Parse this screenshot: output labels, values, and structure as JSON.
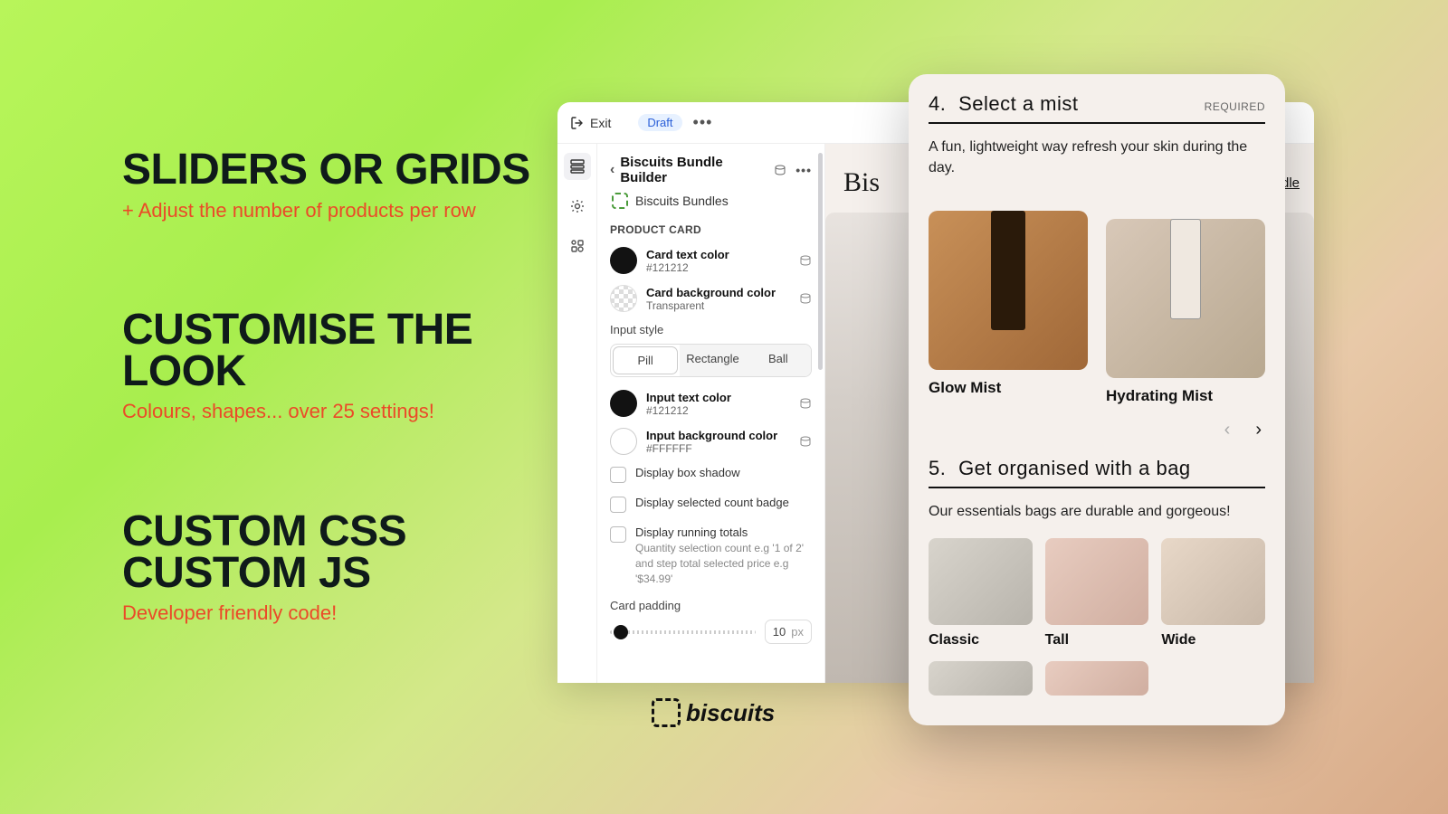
{
  "marketing": {
    "block1": {
      "headline": "SLIDERS OR GRIDS",
      "subline": "+ Adjust the number of products per row"
    },
    "block2": {
      "headline": "CUSTOMISE THE LOOK",
      "subline": "Colours, shapes... over 25 settings!"
    },
    "block3": {
      "headline_a": "CUSTOM CSS",
      "headline_b": "CUSTOM JS",
      "subline": "Developer friendly code!"
    }
  },
  "editor": {
    "exit": "Exit",
    "badge": "Draft",
    "panel_title": "Biscuits Bundle Builder",
    "breadcrumb": "Biscuits Bundles",
    "section": "PRODUCT CARD",
    "card_text_color": {
      "label": "Card text color",
      "value": "#121212"
    },
    "card_bg_color": {
      "label": "Card background color",
      "value": "Transparent"
    },
    "input_style_label": "Input style",
    "input_style": {
      "opt1": "Pill",
      "opt2": "Rectangle",
      "opt3": "Ball"
    },
    "input_text_color": {
      "label": "Input text color",
      "value": "#121212"
    },
    "input_bg_color": {
      "label": "Input background color",
      "value": "#FFFFFF"
    },
    "check_shadow": "Display box shadow",
    "check_badge": "Display selected count badge",
    "check_totals": {
      "label": "Display running totals",
      "sub": "Quantity selection count e.g '1 of 2' and step total selected price e.g '$34.99'"
    },
    "padding_label": "Card padding",
    "padding_value": "10",
    "padding_unit": "px"
  },
  "preview": {
    "brand": "Bis",
    "link": "Skincare Bundle"
  },
  "overlay": {
    "step4": {
      "num": "4.",
      "title": "Select a mist",
      "required": "REQUIRED",
      "desc": "A fun, lightweight way refresh your skin during the day."
    },
    "mist1": "Glow Mist",
    "mist2": "Hydrating Mist",
    "step5": {
      "num": "5.",
      "title": "Get organised with a bag",
      "desc": "Our essentials bags are durable and gorgeous!"
    },
    "bag1": "Classic",
    "bag2": "Tall",
    "bag3": "Wide"
  },
  "footer_brand": "biscuits"
}
